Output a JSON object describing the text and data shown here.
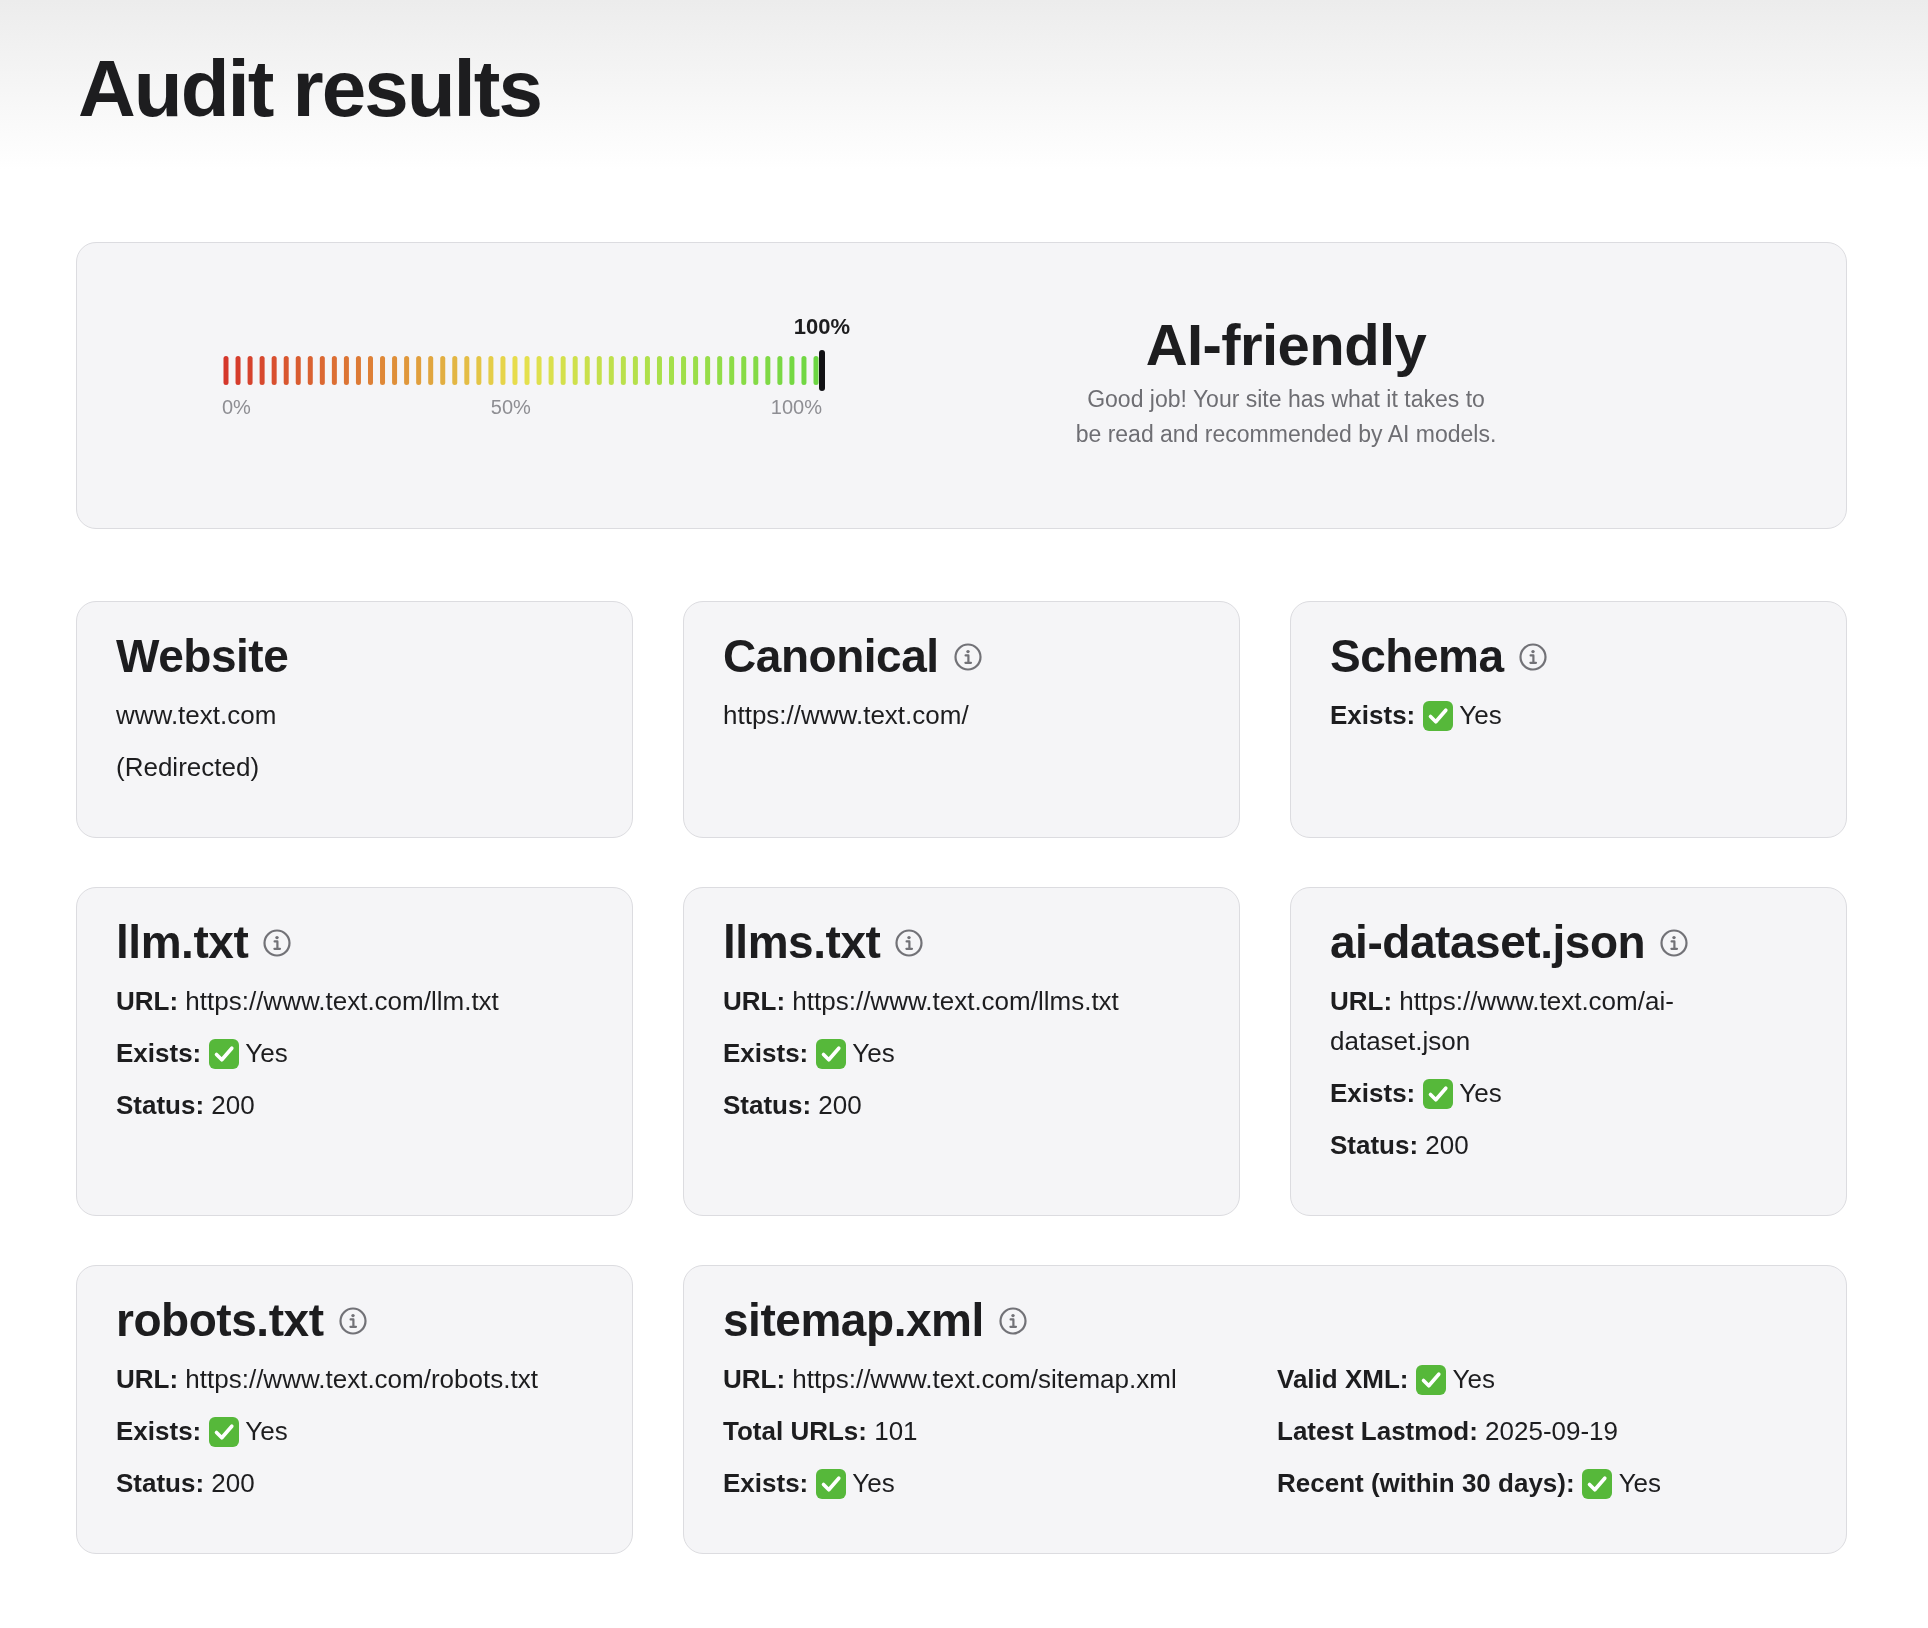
{
  "page": {
    "title": "Audit results"
  },
  "score": {
    "level": 1,
    "value_label": "100%",
    "scale": [
      "0%",
      "50%",
      "100%"
    ],
    "verdict": "AI-friendly",
    "message": "Good job! Your site has what it takes to be read and recommended by AI models."
  },
  "cards": [
    {
      "title": "Website",
      "info": false,
      "columns": [
        [
          {
            "value": "www.text.com"
          },
          {
            "value": "(Redirected)"
          }
        ]
      ]
    },
    {
      "title": "Canonical",
      "info": true,
      "columns": [
        [
          {
            "value": "https://www.text.com/"
          }
        ]
      ]
    },
    {
      "title": "Schema",
      "info": true,
      "columns": [
        [
          {
            "label": "Exists:",
            "passed": true,
            "value": "Yes"
          }
        ]
      ]
    },
    {
      "title": "llm.txt",
      "info": true,
      "columns": [
        [
          {
            "label": "URL:",
            "value": "https://www.text.com/llm.txt"
          },
          {
            "label": "Exists:",
            "passed": true,
            "value": "Yes"
          },
          {
            "label": "Status:",
            "value": "200"
          }
        ]
      ]
    },
    {
      "title": "llms.txt",
      "info": true,
      "columns": [
        [
          {
            "label": "URL:",
            "value": "https://www.text.com/llms.txt"
          },
          {
            "label": "Exists:",
            "passed": true,
            "value": "Yes"
          },
          {
            "label": "Status:",
            "value": "200"
          }
        ]
      ]
    },
    {
      "title": "ai-dataset.json",
      "info": true,
      "columns": [
        [
          {
            "label": "URL:",
            "value": "https://www.text.com/ai-dataset.json"
          },
          {
            "label": "Exists:",
            "passed": true,
            "value": "Yes"
          },
          {
            "label": "Status:",
            "value": "200"
          }
        ]
      ]
    },
    {
      "title": "robots.txt",
      "info": true,
      "columns": [
        [
          {
            "label": "URL:",
            "value": "https://www.text.com/robots.txt"
          },
          {
            "label": "Exists:",
            "passed": true,
            "value": "Yes"
          },
          {
            "label": "Status:",
            "value": "200"
          }
        ]
      ]
    },
    {
      "title": "sitemap.xml",
      "info": true,
      "columns": [
        [
          {
            "label": "URL:",
            "value": "https://www.text.com/sitemap.xml"
          },
          {
            "label": "Total URLs:",
            "value": "101"
          },
          {
            "label": "Exists:",
            "passed": true,
            "value": "Yes"
          }
        ],
        [
          {
            "label": "Valid XML:",
            "passed": true,
            "value": "Yes"
          },
          {
            "label": "Latest Lastmod:",
            "value": "2025-09-19"
          },
          {
            "label": "Recent (within 30 days):",
            "passed": true,
            "value": "Yes"
          }
        ]
      ]
    }
  ]
}
